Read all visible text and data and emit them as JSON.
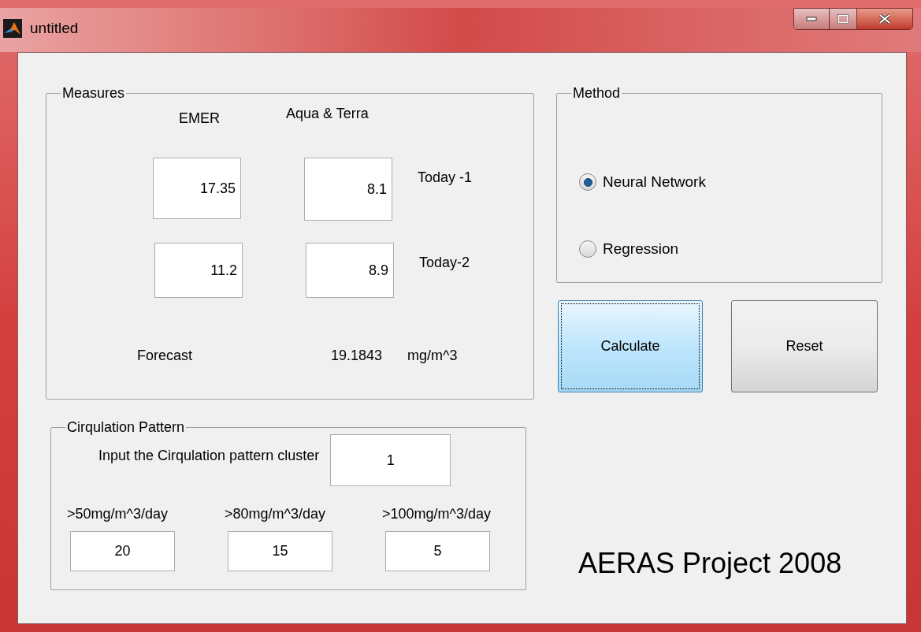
{
  "window": {
    "title": "untitled"
  },
  "measures": {
    "title": "Measures",
    "columns": [
      "EMER",
      "Aqua & Terra"
    ],
    "rows": [
      {
        "label": "Today -1",
        "emer": "17.35",
        "aqua": "8.1"
      },
      {
        "label": "Today-2",
        "emer": "11.2",
        "aqua": "8.9"
      }
    ],
    "forecast": {
      "label": "Forecast",
      "value": "19.1843",
      "unit": "mg/m^3"
    }
  },
  "method": {
    "title": "Method",
    "options": [
      {
        "label": "Neural Network",
        "selected": true
      },
      {
        "label": "Regression",
        "selected": false
      }
    ]
  },
  "buttons": [
    {
      "label": "Calculate",
      "focused": true
    },
    {
      "label": "Reset",
      "focused": false
    }
  ],
  "circulation": {
    "title": "Cirqulation Pattern",
    "cluster_label": "Input the Cirqulation pattern cluster",
    "cluster_value": "1",
    "thresholds": [
      {
        "label": ">50mg/m^3/day",
        "value": "20"
      },
      {
        "label": ">80mg/m^3/day",
        "value": "15"
      },
      {
        "label": ">100mg/m^3/day",
        "value": "5"
      }
    ]
  },
  "footer": "AERAS Project 2008"
}
